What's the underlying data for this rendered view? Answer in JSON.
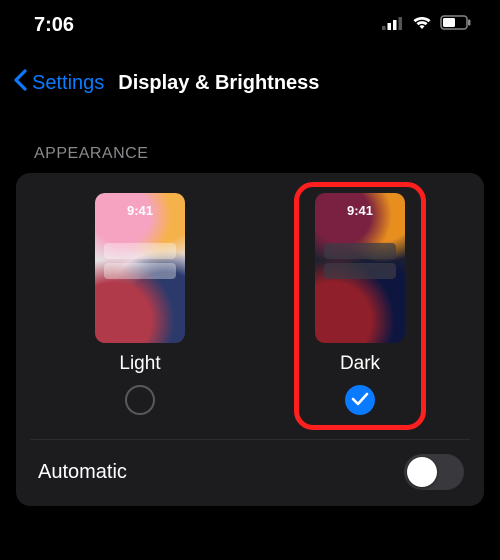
{
  "status": {
    "time": "7:06"
  },
  "nav": {
    "back_label": "Settings",
    "title": "Display & Brightness"
  },
  "section": {
    "header": "Appearance"
  },
  "themes": {
    "light": {
      "label": "Light",
      "thumb_time": "9:41",
      "selected": false
    },
    "dark": {
      "label": "Dark",
      "thumb_time": "9:41",
      "selected": true
    }
  },
  "automatic": {
    "label": "Automatic",
    "on": false
  },
  "colors": {
    "accent": "#0a7aff",
    "highlight": "#ff1f1f"
  }
}
